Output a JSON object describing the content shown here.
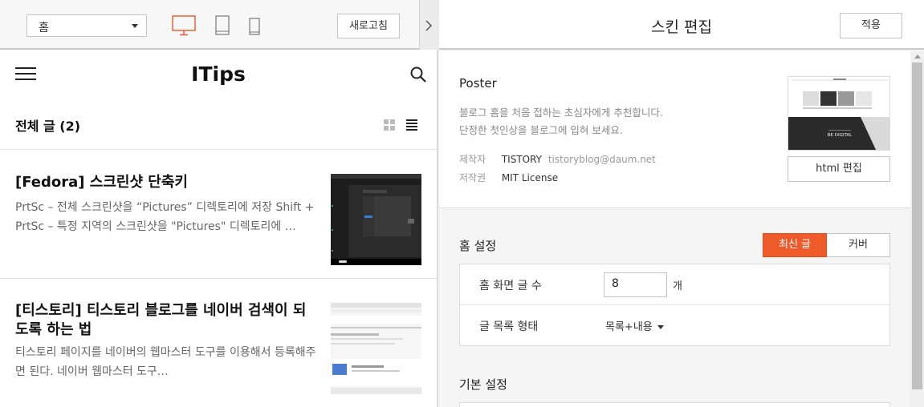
{
  "left_toolbar": {
    "page_select": "홈",
    "refresh_label": "새로고침"
  },
  "blog": {
    "title": "ITips",
    "list_title": "전체 글 (2)",
    "posts": [
      {
        "title": "[Fedora] 스크린샷 단축키",
        "excerpt": "PrtSc – 전체 스크린샷을 “Pictures” 디렉토리에 저장 Shift + PrtSc – 특정 지역의 스크린샷을 \"Pictures\" 디렉토리에 …"
      },
      {
        "title": "[티스토리] 티스토리 블로그를 네이버 검색이 되도록 하는 법",
        "excerpt": "티스토리 페이지를 네이버의 웹마스터 도구를 이용해서 등록해주면 된다. 네이버 웹마스터 도구…"
      }
    ]
  },
  "editor": {
    "title": "스킨 편집",
    "apply_label": "적용",
    "skin": {
      "name": "Poster",
      "desc_line1": "블로그 홈을 처음 접하는 초심자에게 추천합니다.",
      "desc_line2": "단정한 첫인상을 블로그에 입혀 보세요.",
      "maker_label": "제작자",
      "maker_name": "TISTORY",
      "maker_email": "tistoryblog@daum.net",
      "license_label": "저작권",
      "license_value": "MIT License",
      "thumb_text": "BE DIGITAL",
      "html_edit_label": "html 편집"
    },
    "home_settings": {
      "title": "홈 설정",
      "latest_label": "최신 글",
      "cover_label": "커버",
      "count_label": "홈 화면 글 수",
      "count_value": "8",
      "count_unit": "개",
      "format_label": "글 목록 형태",
      "format_value": "목록+내용"
    },
    "basic_settings": {
      "title": "기본 설정"
    }
  },
  "colors": {
    "accent": "#ee5a2a"
  },
  "icons": [
    "desktop-icon",
    "tablet-icon",
    "mobile-icon",
    "chevron-right-icon",
    "hamburger-menu-icon",
    "search-icon",
    "grid-view-icon",
    "list-view-icon"
  ]
}
